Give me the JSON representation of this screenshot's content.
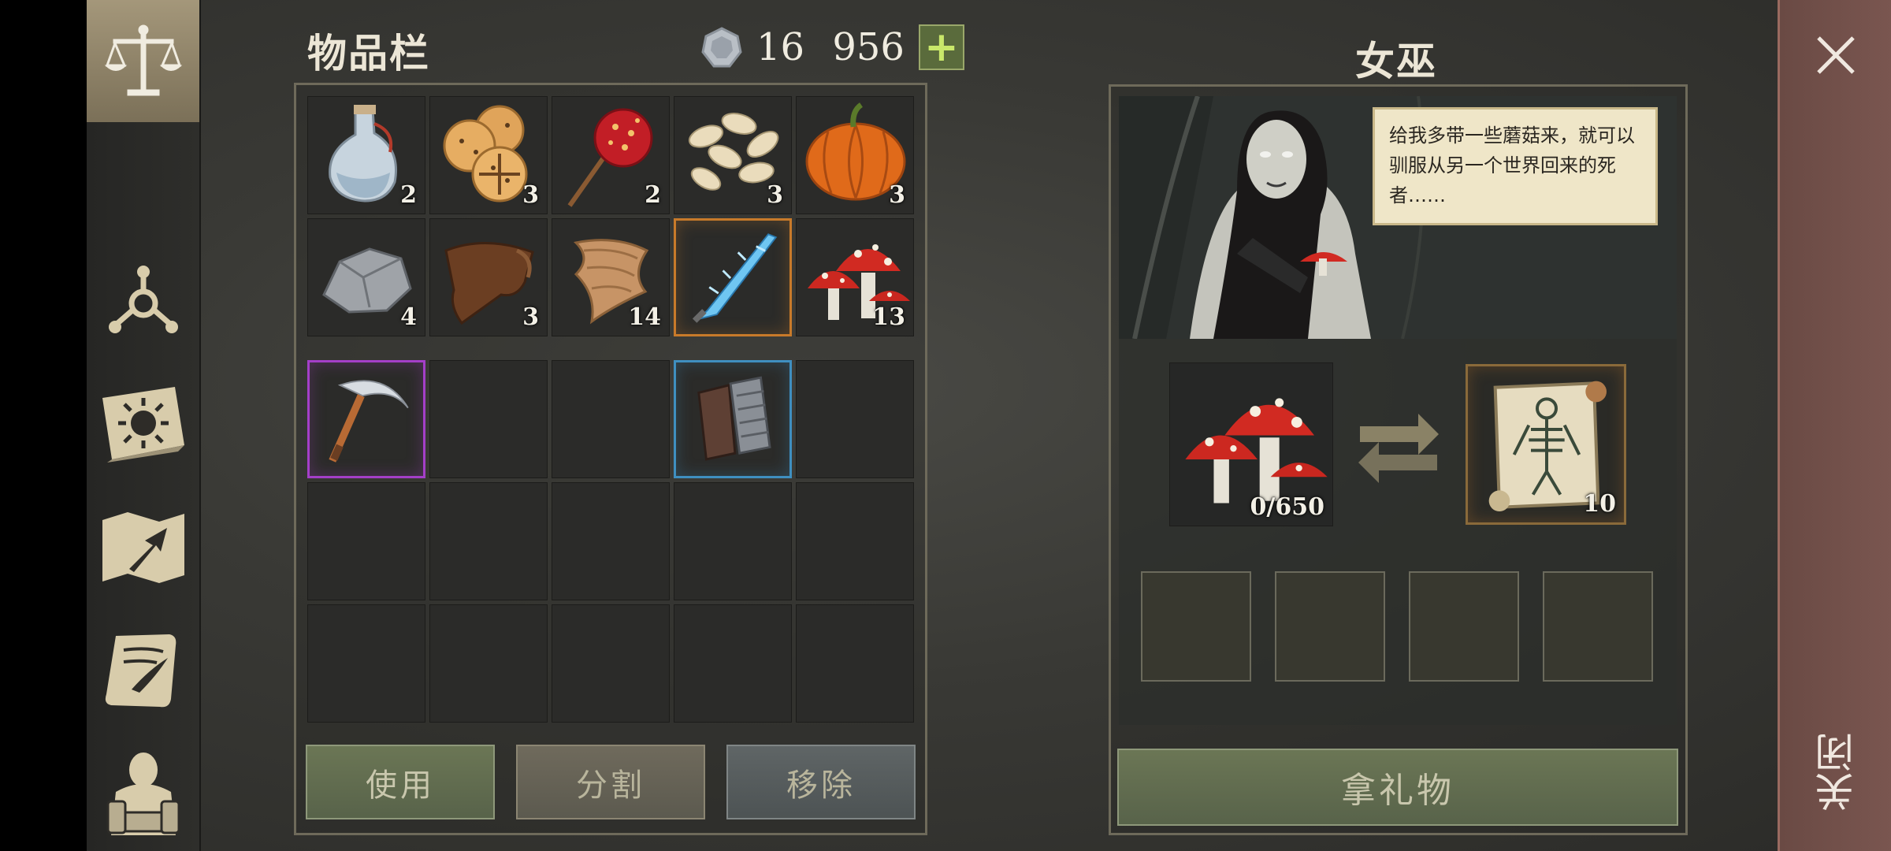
{
  "inventory": {
    "title": "物品栏",
    "currency_value": "16 956",
    "plus_label": "+",
    "items": [
      {
        "name": "potion",
        "count": "2"
      },
      {
        "name": "crackers",
        "count": "3"
      },
      {
        "name": "candy-apple",
        "count": "2"
      },
      {
        "name": "seeds",
        "count": "3"
      },
      {
        "name": "pumpkin",
        "count": "3"
      },
      {
        "name": "stone",
        "count": "4"
      },
      {
        "name": "leather",
        "count": "3"
      },
      {
        "name": "fabric",
        "count": "14"
      },
      {
        "name": "ice-blade",
        "count": ""
      },
      {
        "name": "mushrooms",
        "count": "13"
      }
    ],
    "equip": [
      {
        "name": "sickle"
      },
      {
        "name": "empty"
      },
      {
        "name": "empty"
      },
      {
        "name": "gauntlets"
      },
      {
        "name": "empty"
      }
    ],
    "buttons": {
      "use": "使用",
      "split": "分割",
      "remove": "移除"
    }
  },
  "witch": {
    "title": "女巫",
    "speech": "给我多带一些蘑菇来，就可以驯服从另一个世界回来的死者……",
    "give_item_count": "0/650",
    "receive_item_count": "10",
    "take_gift_label": "拿礼物"
  },
  "close": {
    "label": "关闭"
  },
  "colors": {
    "accent_green": "#5a6b3c",
    "rare_orange": "#c87a2a",
    "rare_purple": "#a43fc8",
    "rare_blue": "#3f8fc0",
    "close_strip": "#7a5650"
  }
}
